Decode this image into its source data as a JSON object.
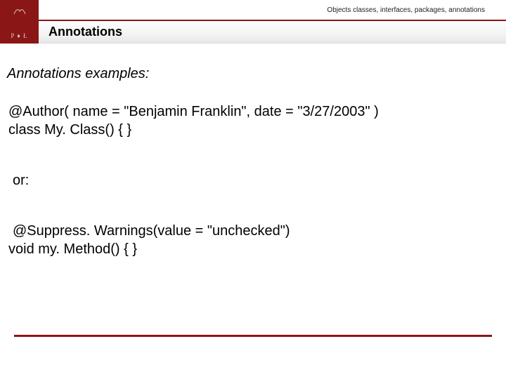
{
  "header": {
    "breadcrumb": "Objects classes, interfaces, packages, annotations",
    "title": "Annotations",
    "logo_letters": "P ♦ Ł"
  },
  "body": {
    "section_heading": "Annotations examples:",
    "example1_line1": "@Author( name = \"Benjamin Franklin\", date = \"3/27/2003\" )",
    "example1_line2": "class My. Class() { }",
    "or_label": "or:",
    "example2_line1": "@Suppress. Warnings(value = \"unchecked\")",
    "example2_line2": "void my. Method() { }"
  }
}
